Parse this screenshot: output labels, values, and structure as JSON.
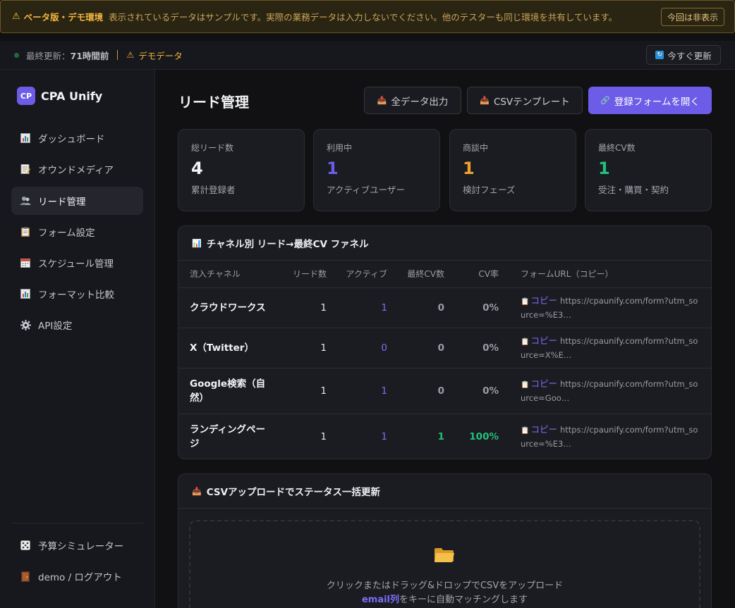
{
  "banner": {
    "title": "ベータ版・デモ環境",
    "message": "表示されているデータはサンプルです。実際の業務データは入力しないでください。他のテスターも同じ環境を共有しています。",
    "hide_button": "今回は非表示"
  },
  "status": {
    "last_update_label": "最終更新：",
    "last_update_value": "71時間前",
    "demo_label": "デモデータ",
    "refresh_button": "今すぐ更新"
  },
  "sidebar": {
    "brand_logo": "CP",
    "brand_name": "CPA Unify",
    "items": [
      {
        "label": "ダッシュボード",
        "icon": "bar-chart-icon"
      },
      {
        "label": "オウンドメディア",
        "icon": "memo-icon"
      },
      {
        "label": "リード管理",
        "icon": "users-icon",
        "active": true
      },
      {
        "label": "フォーム設定",
        "icon": "clipboard-icon"
      },
      {
        "label": "スケジュール管理",
        "icon": "calendar-icon"
      },
      {
        "label": "フォーマット比較",
        "icon": "bar-chart-icon"
      },
      {
        "label": "API設定",
        "icon": "gear-icon"
      }
    ],
    "bottom_items": [
      {
        "label": "予算シミュレーター",
        "icon": "dice-icon"
      },
      {
        "label": "demo / ログアウト",
        "icon": "door-icon"
      }
    ]
  },
  "page": {
    "title": "リード管理",
    "export_button": "全データ出力",
    "csv_template_button": "CSVテンプレート",
    "open_form_button": "登録フォームを開く"
  },
  "stats": [
    {
      "label": "総リード数",
      "value": "4",
      "sub": "累計登録者",
      "color": "#f2f3f5"
    },
    {
      "label": "利用中",
      "value": "1",
      "sub": "アクティブユーザー",
      "color": "#6c5ce7"
    },
    {
      "label": "商談中",
      "value": "1",
      "sub": "検討フェーズ",
      "color": "#f0a030"
    },
    {
      "label": "最終CV数",
      "value": "1",
      "sub": "受注・購買・契約",
      "color": "#22c07a"
    }
  ],
  "funnel": {
    "title": "チャネル別 リード→最終CV ファネル",
    "headers": [
      "流入チャネル",
      "リード数",
      "アクティブ",
      "最終CV数",
      "CV率",
      "フォームURL（コピー）"
    ],
    "rows": [
      {
        "channel": "クラウドワークス",
        "leads": "1",
        "active": "1",
        "cv": "0",
        "rate": "0%",
        "copy": "コピー",
        "url": "https://cpaunify.com/form?utm_source=%E3…"
      },
      {
        "channel": "X（Twitter）",
        "leads": "1",
        "active": "0",
        "cv": "0",
        "rate": "0%",
        "copy": "コピー",
        "url": "https://cpaunify.com/form?utm_source=X%E…"
      },
      {
        "channel": "Google検索（自然）",
        "leads": "1",
        "active": "1",
        "cv": "0",
        "rate": "0%",
        "copy": "コピー",
        "url": "https://cpaunify.com/form?utm_source=Goo…"
      },
      {
        "channel": "ランディングページ",
        "leads": "1",
        "active": "1",
        "cv": "1",
        "rate": "100%",
        "copy": "コピー",
        "url": "https://cpaunify.com/form?utm_source=%E3…"
      }
    ]
  },
  "upload": {
    "title": "CSVアップロードでステータス一括更新",
    "line1": "クリックまたはドラッグ&ドロップでCSVをアップロード",
    "email_key": "email列",
    "line2_rest": "をキーに自動マッチングします"
  },
  "colors": {
    "accent": "#6c5ce7",
    "warning": "#f0a030",
    "success": "#22c07a"
  }
}
